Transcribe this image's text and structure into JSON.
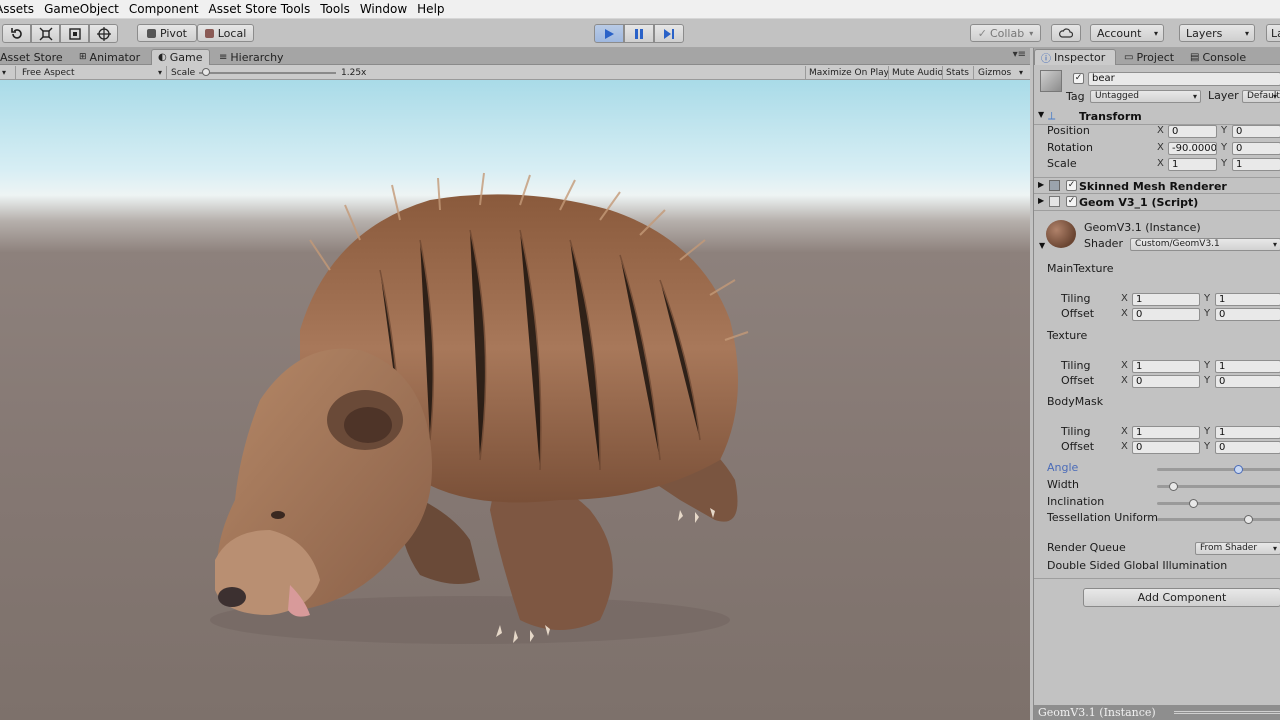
{
  "menu": [
    "Assets",
    "GameObject",
    "Component",
    "Asset Store Tools",
    "Tools",
    "Window",
    "Help"
  ],
  "toolbar": {
    "pivot_label": "Pivot",
    "local_label": "Local",
    "collab_label": "Collab",
    "account_label": "Account",
    "layers_label": "Layers",
    "layout_label": "La"
  },
  "game_panel": {
    "tabs": [
      "Asset Store",
      "Animator",
      "Game",
      "Hierarchy"
    ],
    "aspect": "Free Aspect",
    "scale_label": "Scale",
    "scale_value": "1.25x",
    "scale_fraction": 0.02,
    "maximize": "Maximize On Play",
    "mute": "Mute Audio",
    "stats": "Stats",
    "gizmos": "Gizmos"
  },
  "inspector": {
    "tabs": [
      "Inspector",
      "Project",
      "Console"
    ],
    "object_name": "bear",
    "tag_label": "Tag",
    "tag_value": "Untagged",
    "layer_label": "Layer",
    "layer_value": "Default",
    "transform": {
      "title": "Transform",
      "position_label": "Position",
      "rotation_label": "Rotation",
      "scale_label": "Scale",
      "pos_x": "0",
      "pos_y": "0",
      "rot_x": "-90.0000",
      "rot_y": "0",
      "scale_x": "1",
      "scale_y": "1"
    },
    "skinned_mesh": "Skinned Mesh Renderer",
    "geom_script": "Geom V3_1 (Script)",
    "material": {
      "name": "GeomV3.1 (Instance)",
      "shader_label": "Shader",
      "shader_value": "Custom/GeomV3.1"
    },
    "textures": [
      {
        "name": "MainTexture",
        "tiling_x": "1",
        "tiling_y": "1",
        "offset_x": "0",
        "offset_y": "0"
      },
      {
        "name": "Texture",
        "tiling_x": "1",
        "tiling_y": "1",
        "offset_x": "0",
        "offset_y": "0"
      },
      {
        "name": "BodyMask",
        "tiling_x": "1",
        "tiling_y": "1",
        "offset_x": "0",
        "offset_y": "0"
      }
    ],
    "tiling_label": "Tiling",
    "offset_label": "Offset",
    "axis_x": "X",
    "axis_y": "Y",
    "sliders": [
      {
        "label": "Angle",
        "fraction": 0.65,
        "active": true
      },
      {
        "label": "Width",
        "fraction": 0.13
      },
      {
        "label": "Inclination",
        "fraction": 0.29
      },
      {
        "label": "Tessellation Uniform",
        "fraction": 0.73
      }
    ],
    "render_queue_label": "Render Queue",
    "render_queue_value": "From Shader",
    "double_sided_gi": "Double Sided Global Illumination",
    "add_component": "Add Component",
    "status": "GeomV3.1 (Instance)"
  },
  "colors": {
    "accent_blue": "#4a6bb8",
    "play_active": "#9fb8df",
    "bear_fur": "#a0714f"
  }
}
